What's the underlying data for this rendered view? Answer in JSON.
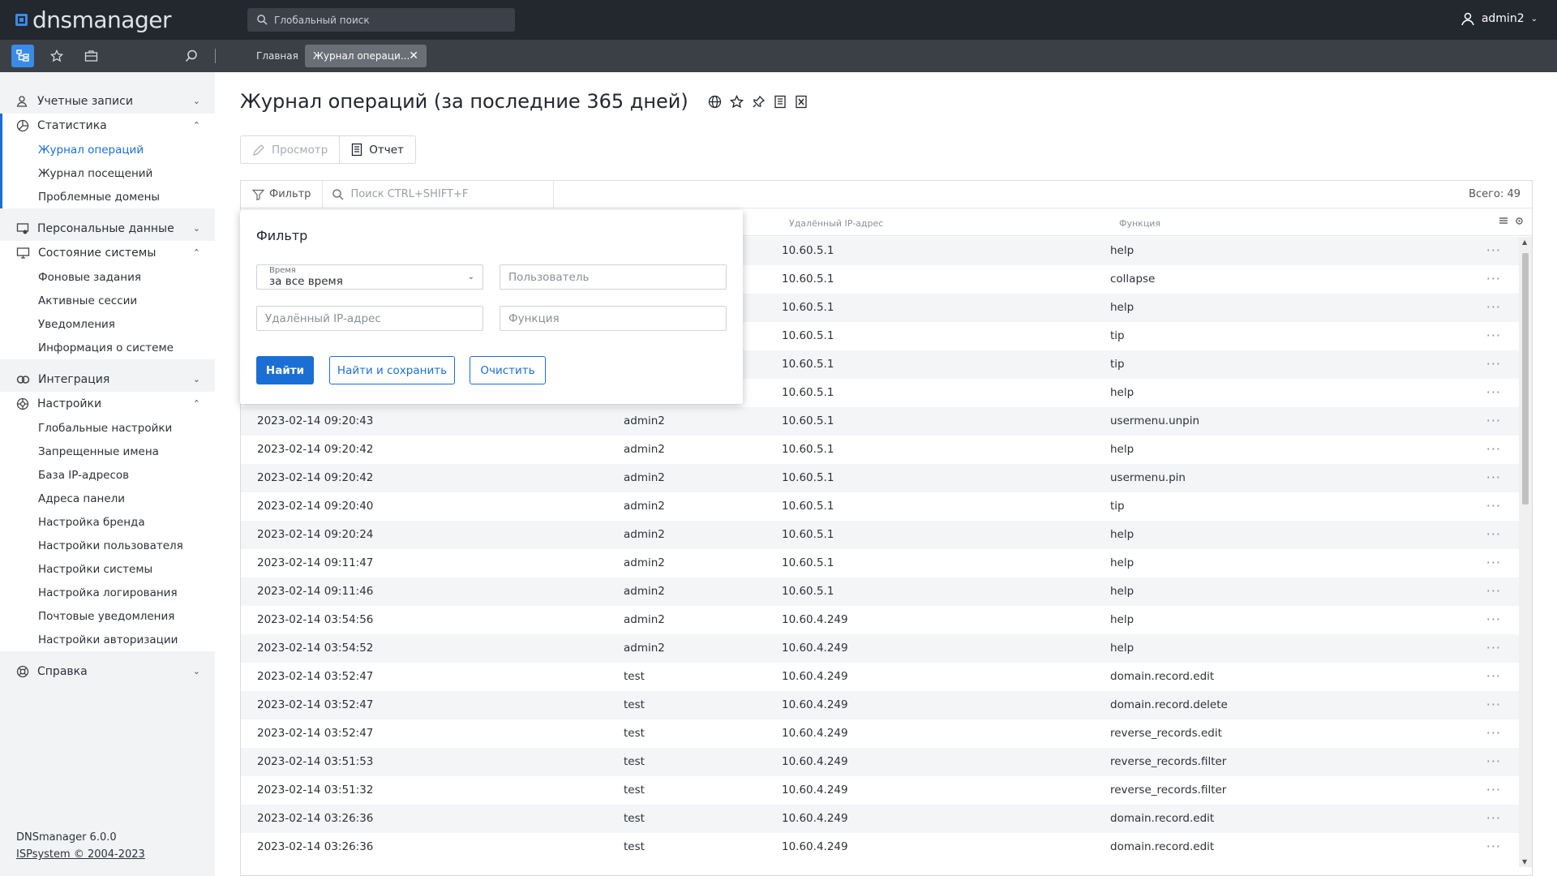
{
  "app": {
    "logo_text": "dnsmanager",
    "search_placeholder": "Глобальный поиск",
    "user": "admin2"
  },
  "tabs": {
    "home": "Главная",
    "active": "Журнал операци..."
  },
  "sidebar": {
    "groups": [
      {
        "label": "Учетные записи",
        "icon": "users-icon",
        "open": false,
        "items": []
      },
      {
        "label": "Статистика",
        "icon": "chart-icon",
        "open": true,
        "items": [
          "Журнал операций",
          "Журнал посещений",
          "Проблемные домены"
        ]
      },
      {
        "label": "Персональные данные",
        "icon": "personal-data-icon",
        "open": false,
        "items": []
      },
      {
        "label": "Состояние системы",
        "icon": "monitor-icon",
        "open": true,
        "items": [
          "Фоновые задания",
          "Активные сессии",
          "Уведомления",
          "Информация о системе"
        ]
      },
      {
        "label": "Интеграция",
        "icon": "integration-icon",
        "open": false,
        "items": []
      },
      {
        "label": "Настройки",
        "icon": "settings-icon",
        "open": true,
        "items": [
          "Глобальные настройки",
          "Запрещенные имена",
          "База IP-адресов",
          "Адреса панели",
          "Настройка бренда",
          "Настройки пользователя",
          "Настройки системы",
          "Настройка логирования",
          "Почтовые уведомления",
          "Настройки авторизации"
        ]
      },
      {
        "label": "Справка",
        "icon": "help-icon",
        "open": false,
        "items": []
      }
    ],
    "footer": {
      "version": "DNSmanager 6.0.0",
      "copyright": "ISPsystem © 2004-2023"
    }
  },
  "page": {
    "title": "Журнал операций (за последние 365 дней)",
    "toolbar": {
      "view": "Просмотр",
      "report": "Отчет"
    },
    "filter_label": "Фильтр",
    "search_placeholder": "Поиск CTRL+SHIFT+F",
    "total": "Всего: 49",
    "columns": {
      "ip": "Удалённый IP-адрес",
      "function": "Функция"
    }
  },
  "filter_panel": {
    "title": "Фильтр",
    "time_label": "Время",
    "time_value": "за все время",
    "user_placeholder": "Пользователь",
    "ip_placeholder": "Удалённый IP-адрес",
    "function_placeholder": "Функция",
    "find": "Найти",
    "find_save": "Найти и сохранить",
    "clear": "Очистить"
  },
  "rows": [
    {
      "time": "",
      "user": "",
      "ip": "10.60.5.1",
      "func": "help"
    },
    {
      "time": "",
      "user": "",
      "ip": "10.60.5.1",
      "func": "collapse"
    },
    {
      "time": "",
      "user": "",
      "ip": "10.60.5.1",
      "func": "help"
    },
    {
      "time": "",
      "user": "",
      "ip": "10.60.5.1",
      "func": "tip"
    },
    {
      "time": "",
      "user": "",
      "ip": "10.60.5.1",
      "func": "tip"
    },
    {
      "time": "",
      "user": "",
      "ip": "10.60.5.1",
      "func": "help"
    },
    {
      "time": "2023-02-14 09:20:43",
      "user": "admin2",
      "ip": "10.60.5.1",
      "func": "usermenu.unpin"
    },
    {
      "time": "2023-02-14 09:20:42",
      "user": "admin2",
      "ip": "10.60.5.1",
      "func": "help"
    },
    {
      "time": "2023-02-14 09:20:42",
      "user": "admin2",
      "ip": "10.60.5.1",
      "func": "usermenu.pin"
    },
    {
      "time": "2023-02-14 09:20:40",
      "user": "admin2",
      "ip": "10.60.5.1",
      "func": "tip"
    },
    {
      "time": "2023-02-14 09:20:24",
      "user": "admin2",
      "ip": "10.60.5.1",
      "func": "help"
    },
    {
      "time": "2023-02-14 09:11:47",
      "user": "admin2",
      "ip": "10.60.5.1",
      "func": "help"
    },
    {
      "time": "2023-02-14 09:11:46",
      "user": "admin2",
      "ip": "10.60.5.1",
      "func": "help"
    },
    {
      "time": "2023-02-14 03:54:56",
      "user": "admin2",
      "ip": "10.60.4.249",
      "func": "help"
    },
    {
      "time": "2023-02-14 03:54:52",
      "user": "admin2",
      "ip": "10.60.4.249",
      "func": "help"
    },
    {
      "time": "2023-02-14 03:52:47",
      "user": "test",
      "ip": "10.60.4.249",
      "func": "domain.record.edit"
    },
    {
      "time": "2023-02-14 03:52:47",
      "user": "test",
      "ip": "10.60.4.249",
      "func": "domain.record.delete"
    },
    {
      "time": "2023-02-14 03:52:47",
      "user": "test",
      "ip": "10.60.4.249",
      "func": "reverse_records.edit"
    },
    {
      "time": "2023-02-14 03:51:53",
      "user": "test",
      "ip": "10.60.4.249",
      "func": "reverse_records.filter"
    },
    {
      "time": "2023-02-14 03:51:32",
      "user": "test",
      "ip": "10.60.4.249",
      "func": "reverse_records.filter"
    },
    {
      "time": "2023-02-14 03:26:36",
      "user": "test",
      "ip": "10.60.4.249",
      "func": "domain.record.edit"
    },
    {
      "time": "2023-02-14 03:26:36",
      "user": "test",
      "ip": "10.60.4.249",
      "func": "domain.record.edit"
    }
  ]
}
